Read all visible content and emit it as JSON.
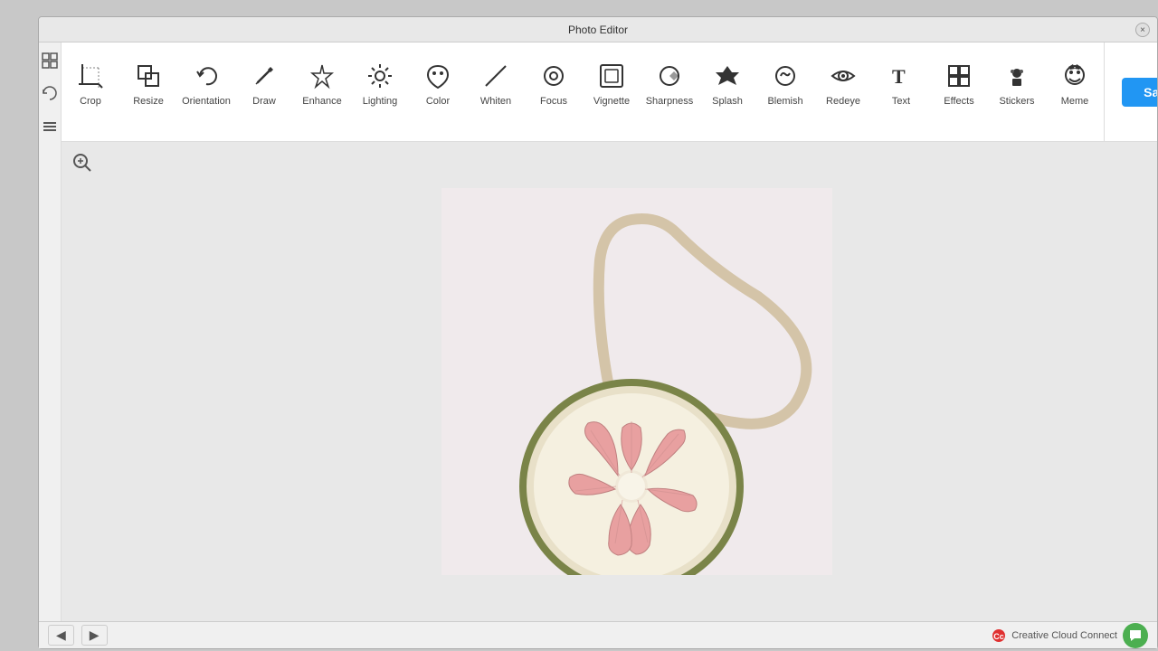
{
  "window": {
    "title": "Photo Editor",
    "close_label": "×"
  },
  "toolbar": {
    "tools": [
      {
        "id": "crop",
        "label": "Crop",
        "icon": "⊹"
      },
      {
        "id": "resize",
        "label": "Resize",
        "icon": "⊞"
      },
      {
        "id": "orientation",
        "label": "Orientation",
        "icon": "↺"
      },
      {
        "id": "draw",
        "label": "Draw",
        "icon": "✏"
      },
      {
        "id": "enhance",
        "label": "Enhance",
        "icon": "✦"
      },
      {
        "id": "lighting",
        "label": "Lighting",
        "icon": "⚙"
      },
      {
        "id": "color",
        "label": "Color",
        "icon": "❋"
      },
      {
        "id": "whiten",
        "label": "Whiten",
        "icon": "╱"
      },
      {
        "id": "focus",
        "label": "Focus",
        "icon": "◎"
      },
      {
        "id": "vignette",
        "label": "Vignette",
        "icon": "▣"
      },
      {
        "id": "sharpness",
        "label": "Sharpness",
        "icon": "◈"
      },
      {
        "id": "splash",
        "label": "Splash",
        "icon": "◆"
      },
      {
        "id": "blemish",
        "label": "Blemish",
        "icon": "⟳"
      },
      {
        "id": "redeye",
        "label": "Redeye",
        "icon": "👁"
      },
      {
        "id": "text",
        "label": "Text",
        "icon": "T"
      },
      {
        "id": "effects",
        "label": "Effects",
        "icon": "⊡"
      },
      {
        "id": "stickers",
        "label": "Stickers",
        "icon": "🎩"
      },
      {
        "id": "meme",
        "label": "Meme",
        "icon": "🐱"
      }
    ],
    "save_label": "Save"
  },
  "canvas": {
    "zoom_icon": "🔍"
  },
  "bottom_bar": {
    "back_label": "◀",
    "forward_label": "▶",
    "brand_text": "Creative Cloud Connect"
  }
}
